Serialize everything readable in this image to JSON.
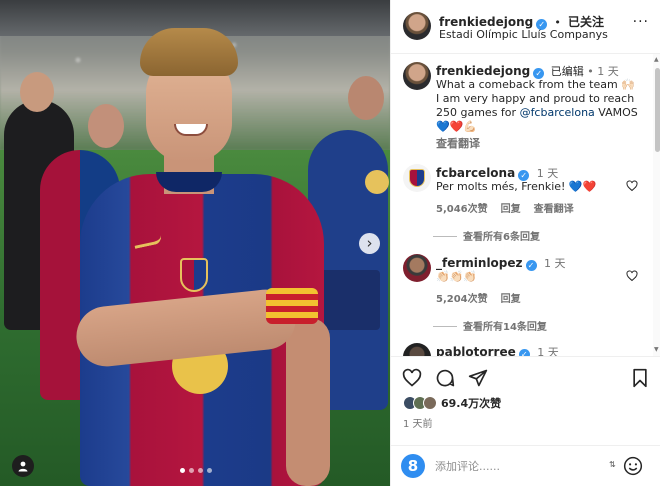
{
  "post": {
    "username": "frenkiedejong",
    "follow_label": "已关注",
    "separator": "•",
    "location": "Estadi Olímpic Lluís Companys",
    "more_label": "···"
  },
  "caption": {
    "username": "frenkiedejong",
    "edited_label": "已编辑",
    "separator": "•",
    "time": "1 天",
    "text_line1": "What a comeback from the team 🙌🏻",
    "text_line2": "I am very happy and proud to reach",
    "text_line3_prefix": "250 games for ",
    "mention": "@fcbarcelona",
    "text_line3_suffix": " VAMOS",
    "hearts": "💙❤️💪🏻",
    "translate_label": "查看翻译"
  },
  "comments": [
    {
      "username": "fcbarcelona",
      "time": "1 天",
      "text": "Per molts més, Frenkie! 💙❤️",
      "likes": "5,046次赞",
      "reply_label": "回复",
      "translate_label": "查看翻译",
      "view_replies": "查看所有6条回复"
    },
    {
      "username": "_ferminlopez",
      "time": "1 天",
      "text": "👏🏻👏🏻👏🏻",
      "likes": "5,204次赞",
      "reply_label": "回复",
      "view_replies": "查看所有14条回复"
    },
    {
      "username": "pablotorree",
      "time": "1 天"
    }
  ],
  "footer": {
    "likes_count": "69.4万次赞",
    "time_ago": "1 天前",
    "comment_placeholder": "添加评论......",
    "smile_glyph": "8"
  },
  "icons": {
    "heart": "heart-icon",
    "comment": "comment-icon",
    "share": "send-icon",
    "save": "bookmark-icon",
    "next": "chevron-right-icon",
    "tag": "user-tag-icon",
    "emoji": "emoji-icon",
    "sort": "sort-icon"
  },
  "carousel": {
    "next_glyph": "›",
    "slides": 4,
    "active": 0
  },
  "colors": {
    "verified": "#3897f0",
    "link": "#00376b",
    "barca_red": "#a8123c",
    "barca_blue": "#1c3c8c"
  }
}
